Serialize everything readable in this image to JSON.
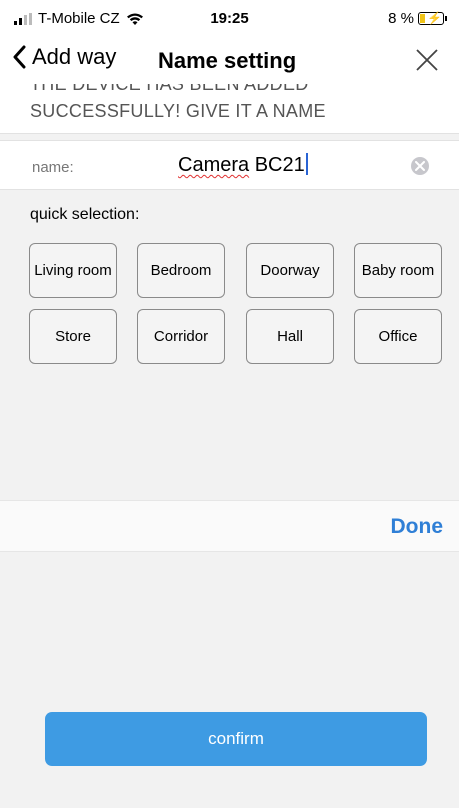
{
  "status_bar": {
    "carrier": "T-Mobile CZ",
    "time": "19:25",
    "battery_percent": "8 %"
  },
  "nav": {
    "back_label": "Add way",
    "title": "Name setting"
  },
  "banner": {
    "line1": "THE DEVICE HAS BEEN ADDED",
    "line2": "SUCCESSFULLY! GIVE IT A NAME"
  },
  "name_field": {
    "label": "name:",
    "value_word1": "Camera",
    "value_word2": " BC21"
  },
  "quick_selection": {
    "title": "quick selection:",
    "options": [
      "Living room",
      "Bedroom",
      "Doorway",
      "Baby room",
      "Store",
      "Corridor",
      "Hall",
      "Office"
    ]
  },
  "keyboard_toolbar": {
    "done_label": "Done"
  },
  "confirm": {
    "label": "confirm"
  },
  "colors": {
    "accent": "#3e9be3",
    "done_text": "#2f7fd6"
  }
}
